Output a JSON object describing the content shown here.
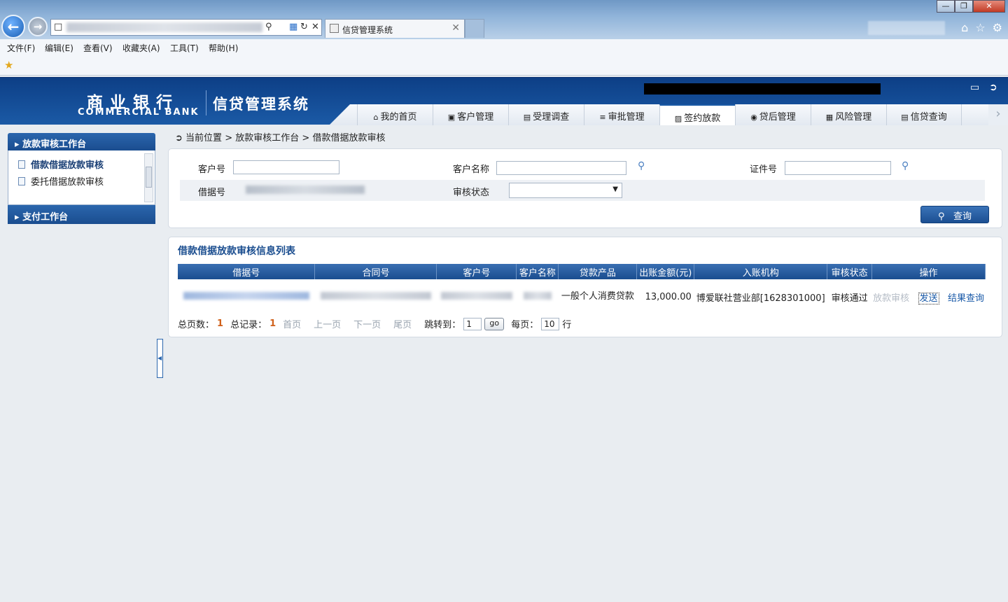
{
  "browser": {
    "tab_title": "信贷管理系统",
    "menu": [
      "文件(F)",
      "编辑(E)",
      "查看(V)",
      "收藏夹(A)",
      "工具(T)",
      "帮助(H)"
    ]
  },
  "header": {
    "logo_cn": "商业银行",
    "logo_en": "COMMERCIAL BANK",
    "system_title": "信贷管理系统",
    "nav": [
      {
        "label": "我的首页",
        "icon": "home-icon"
      },
      {
        "label": "客户管理",
        "icon": "customer-icon"
      },
      {
        "label": "受理调查",
        "icon": "survey-icon"
      },
      {
        "label": "审批管理",
        "icon": "approval-icon"
      },
      {
        "label": "签约放款",
        "icon": "contract-icon",
        "active": true
      },
      {
        "label": "贷后管理",
        "icon": "postloan-icon"
      },
      {
        "label": "风险管理",
        "icon": "risk-icon"
      },
      {
        "label": "信贷查询",
        "icon": "query-icon"
      }
    ]
  },
  "sidebar": {
    "section1": "放款审核工作台",
    "items": [
      {
        "label": "借款借据放款审核",
        "active": true
      },
      {
        "label": "委托借据放款审核"
      }
    ],
    "section2": "支付工作台"
  },
  "breadcrumb": {
    "prefix": "当前位置",
    "sep": ">",
    "level1": "放款审核工作台",
    "level2": "借款借据放款审核"
  },
  "search": {
    "customer_no_label": "客户号",
    "customer_name_label": "客户名称",
    "id_no_label": "证件号",
    "loan_no_label": "借据号",
    "audit_status_label": "审核状态",
    "query_button": "查询"
  },
  "list": {
    "title": "借款借据放款审核信息列表",
    "columns": [
      "借据号",
      "合同号",
      "客户号",
      "客户名称",
      "贷款产品",
      "出账金额(元)",
      "入账机构",
      "审核状态",
      "操作"
    ],
    "rows": [
      {
        "product": "一般个人消费贷款",
        "amount": "13,000.00",
        "institution": "博爱联社营业部[1628301000]",
        "status": "审核通过",
        "op_audit": "放款审核",
        "op_send": "发送",
        "op_result": "结果查询"
      }
    ]
  },
  "pager": {
    "total_pages_label": "总页数：",
    "total_pages": "1",
    "total_records_label": "总记录：",
    "total_records": "1",
    "first": "首页",
    "prev": "上一页",
    "next": "下一页",
    "last": "尾页",
    "jump_label": "跳转到：",
    "jump_value": "1",
    "go": "go",
    "per_page_label": "每页：",
    "per_page": "10",
    "row_unit": "行"
  }
}
